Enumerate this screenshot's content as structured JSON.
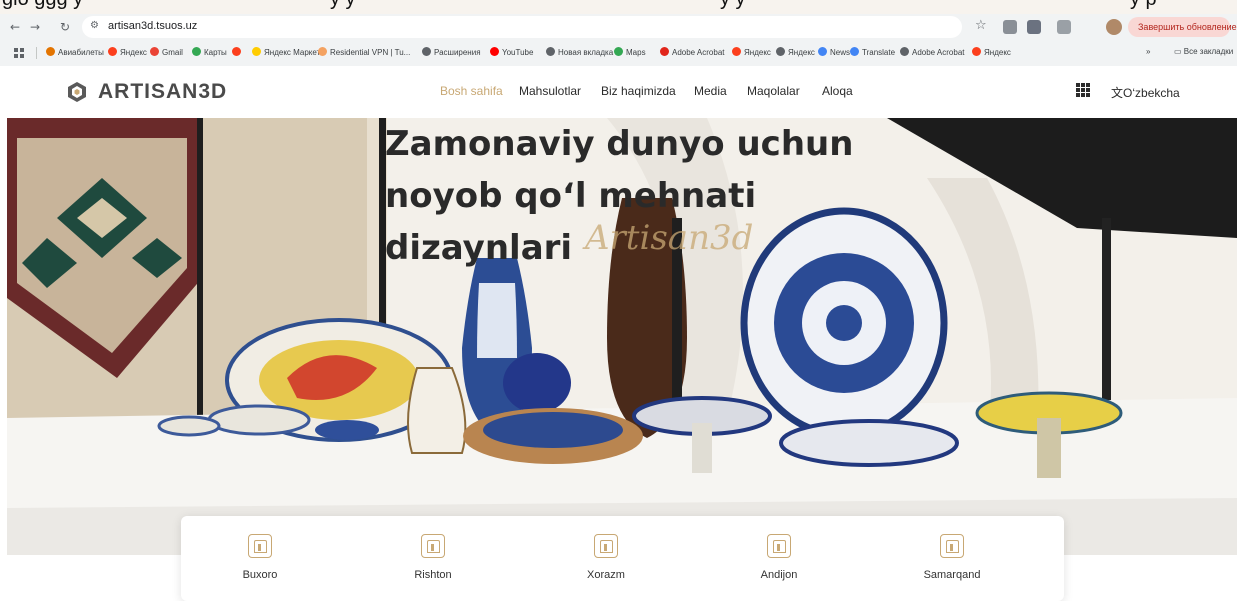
{
  "top_strip": {
    "fragments": [
      "glo ggg y",
      "y y",
      "y y",
      "y p"
    ]
  },
  "browser": {
    "url": "artisan3d.tsuos.uz",
    "update_button": "Завершить обновление",
    "bookmarks": [
      {
        "label": "Авиабилеты",
        "color": "#e37400"
      },
      {
        "label": "Яндекс",
        "color": "#fc3f1d"
      },
      {
        "label": "Gmail",
        "color": "#ea4335"
      },
      {
        "label": "Карты",
        "color": "#34a853"
      },
      {
        "label": "",
        "color": "#fc3f1d"
      },
      {
        "label": "Яндекс Маркет",
        "color": "#ffcc00"
      },
      {
        "label": "Residential VPN | Tu...",
        "color": "#f4a261"
      },
      {
        "label": "Расширения",
        "color": "#5f6368"
      },
      {
        "label": "YouTube",
        "color": "#ff0000"
      },
      {
        "label": "Новая вкладка",
        "color": "#5f6368"
      },
      {
        "label": "Maps",
        "color": "#34a853"
      },
      {
        "label": "Adobe Acrobat",
        "color": "#e1251b"
      },
      {
        "label": "Яндекс",
        "color": "#fc3f1d"
      },
      {
        "label": "Яндекс",
        "color": "#5f6368"
      },
      {
        "label": "News",
        "color": "#4285f4"
      },
      {
        "label": "Translate",
        "color": "#4285f4"
      },
      {
        "label": "Adobe Acrobat",
        "color": "#5f6368"
      },
      {
        "label": "Яндекс",
        "color": "#fc3f1d"
      }
    ],
    "more": "»",
    "all_bookmarks": "Все закладки"
  },
  "site": {
    "logo": "ARTISAN3D",
    "menu": [
      "Bosh sahifa",
      "Mahsulotlar",
      "Biz haqimizda",
      "Media",
      "Maqolalar",
      "Aloqa"
    ],
    "language": "O‘zbekcha",
    "accent": "#c8a874"
  },
  "hero": {
    "title_lines": [
      "Zamonaviy dunyo uchun",
      "noyob qo‘l mehnati",
      "dizaynlari"
    ],
    "script": "Artisan3d"
  },
  "cities": [
    "Buxoro",
    "Rishton",
    "Xorazm",
    "Andijon",
    "Samarqand"
  ]
}
